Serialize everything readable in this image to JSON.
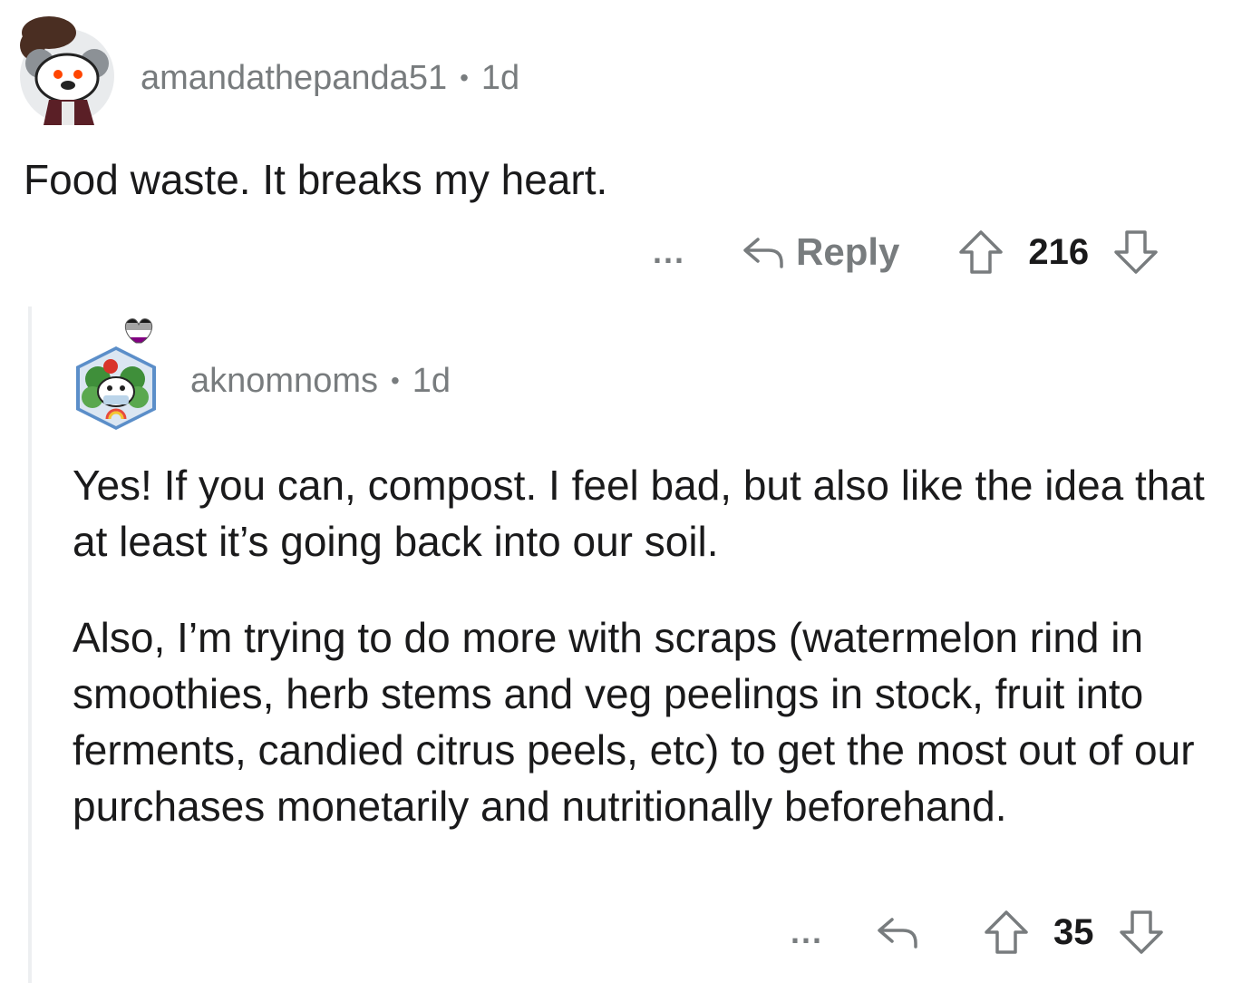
{
  "parent": {
    "username": "amandathepanda51",
    "age": "1d",
    "body": "Food waste. It breaks my heart.",
    "more_label": "...",
    "reply_label": "Reply",
    "score": "216"
  },
  "child": {
    "username": "aknomnoms",
    "age": "1d",
    "paragraphs": [
      "Yes! If you can, compost. I feel bad, but also like the idea that at least it’s going back into our soil.",
      "Also, I’m trying to do more with scraps (watermelon rind in smoothies, herb stems and veg peelings in stock, fruit into ferments, candied citrus peels, etc) to get the most out of our purchases monetarily and nutritionally beforehand."
    ],
    "more_label": "...",
    "score": "35"
  },
  "icons": {
    "reply": "reply-arrow-icon",
    "upvote": "upvote-arrow-icon",
    "downvote": "downvote-arrow-icon"
  },
  "colors": {
    "meta_text": "#787c7e",
    "body_text": "#1a1a1b",
    "thread_line": "#edeff1"
  }
}
